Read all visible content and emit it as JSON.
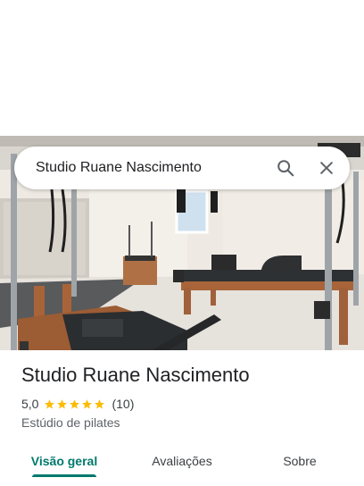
{
  "search": {
    "query": "Studio Ruane Nascimento",
    "search_icon": "search-icon",
    "close_icon": "close-icon"
  },
  "place": {
    "name": "Studio Ruane Nascimento",
    "rating": "5,0",
    "stars": 5,
    "review_count": "(10)",
    "category": "Estúdio de pilates"
  },
  "tabs": [
    {
      "label": "Visão geral",
      "active": true
    },
    {
      "label": "Avaliações",
      "active": false
    },
    {
      "label": "Sobre",
      "active": false
    }
  ],
  "colors": {
    "accent": "#00796b",
    "star": "#fbbc04"
  }
}
